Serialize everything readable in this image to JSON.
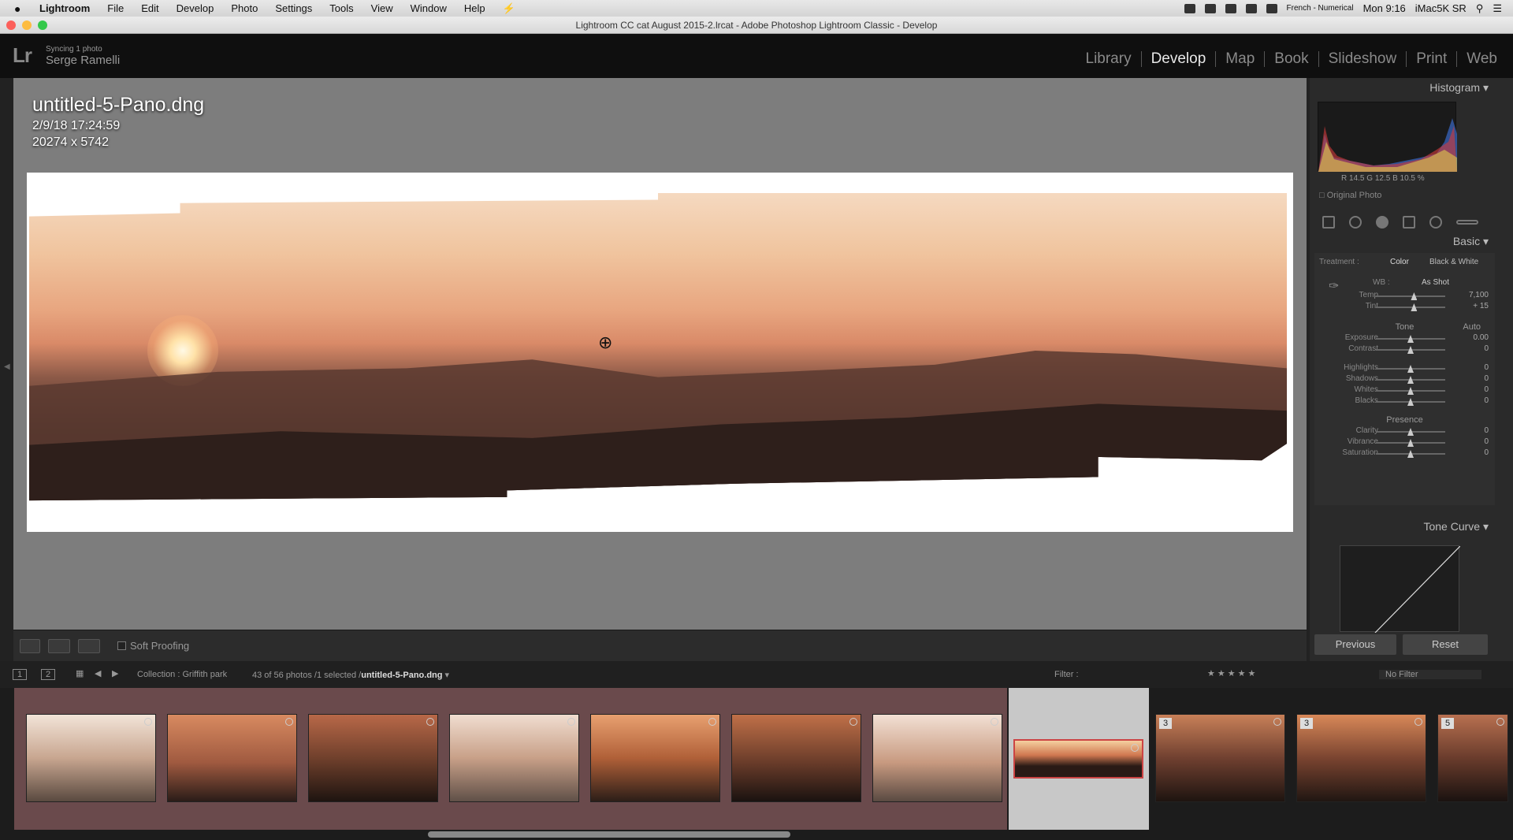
{
  "menubar": {
    "apple": "",
    "app": "Lightroom",
    "items": [
      "File",
      "Edit",
      "Develop",
      "Photo",
      "Settings",
      "Tools",
      "View",
      "Window",
      "Help"
    ],
    "input_source": "French - Numerical",
    "clock": "Mon 9:16",
    "machine": "iMac5K SR"
  },
  "window": {
    "title": "Lightroom CC cat August 2015-2.lrcat - Adobe Photoshop Lightroom Classic - Develop"
  },
  "identity": {
    "sync": "Syncing 1 photo",
    "user": "Serge Ramelli",
    "logo": "Lr"
  },
  "modules": [
    {
      "label": "Library"
    },
    {
      "label": "Develop"
    },
    {
      "label": "Map"
    },
    {
      "label": "Book"
    },
    {
      "label": "Slideshow"
    },
    {
      "label": "Print"
    },
    {
      "label": "Web"
    }
  ],
  "photo_info": {
    "filename": "untitled-5-Pano.dng",
    "date": "2/9/18 17:24:59",
    "dimensions": "20274 x 5742"
  },
  "center_toolbar": {
    "soft_proofing": "Soft Proofing"
  },
  "right_panel": {
    "histogram_title": "Histogram",
    "histogram_values": {
      "r_label": "R",
      "r": "14.5",
      "g_label": "G",
      "g": "12.5",
      "b_label": "B",
      "b": "10.5 %"
    },
    "original_photo": "Original Photo",
    "basic_title": "Basic",
    "treatment_label": "Treatment :",
    "treatment_color": "Color",
    "treatment_bw": "Black & White",
    "wb_label": "WB :",
    "wb_value": "As Shot",
    "tone_label": "Tone",
    "tone_auto": "Auto",
    "presence_label": "Presence",
    "tone_curve_title": "Tone Curve",
    "sliders": [
      {
        "label": "Temp",
        "value": "7,100",
        "pos": 0.55
      },
      {
        "label": "Tint",
        "value": "+ 15",
        "pos": 0.55
      },
      {
        "label": "Exposure",
        "value": "0.00",
        "pos": 0.5
      },
      {
        "label": "Contrast",
        "value": "0",
        "pos": 0.5
      },
      {
        "label": "Highlights",
        "value": "0",
        "pos": 0.5
      },
      {
        "label": "Shadows",
        "value": "0",
        "pos": 0.5
      },
      {
        "label": "Whites",
        "value": "0",
        "pos": 0.5
      },
      {
        "label": "Blacks",
        "value": "0",
        "pos": 0.5
      },
      {
        "label": "Clarity",
        "value": "0",
        "pos": 0.5
      },
      {
        "label": "Vibrance",
        "value": "0",
        "pos": 0.5
      },
      {
        "label": "Saturation",
        "value": "0",
        "pos": 0.5
      }
    ],
    "previous": "Previous",
    "reset": "Reset"
  },
  "filmstrip_bar": {
    "view1": "1",
    "view2": "2",
    "collection": "Collection : Griffith park",
    "count": "43 of 56 photos /1 selected /",
    "selected_file": "untitled-5-Pano.dng",
    "filter_label": "Filter :",
    "filter_value": "No Filter"
  },
  "thumbnails": [
    {
      "badge": ""
    },
    {
      "badge": ""
    },
    {
      "badge": ""
    },
    {
      "badge": ""
    },
    {
      "badge": ""
    },
    {
      "badge": ""
    },
    {
      "badge": ""
    },
    {
      "badge": "",
      "selected": true
    },
    {
      "badge": "3"
    },
    {
      "badge": "3"
    },
    {
      "badge": "5"
    }
  ],
  "colors": {
    "accent_active": "#e8e8e8",
    "selection": "#c8c8c8",
    "filmstrip_bg": "#6a4a4c"
  }
}
